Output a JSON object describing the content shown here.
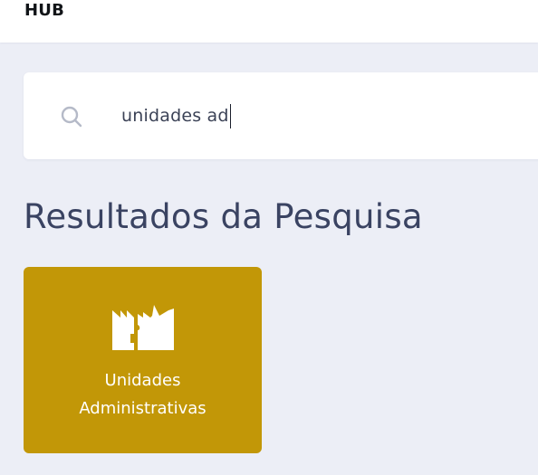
{
  "header": {
    "brand": "HUB"
  },
  "search": {
    "value": "unidades ad",
    "icon": "search-icon"
  },
  "results": {
    "title": "Resultados da Pesquisa",
    "items": [
      {
        "label_line1": "Unidades",
        "label_line2": "Administrativas",
        "icon": "building-icon",
        "color": "#c29707"
      }
    ]
  },
  "colors": {
    "background": "#eceef6",
    "accent": "#c29707",
    "title": "#3a4362"
  }
}
